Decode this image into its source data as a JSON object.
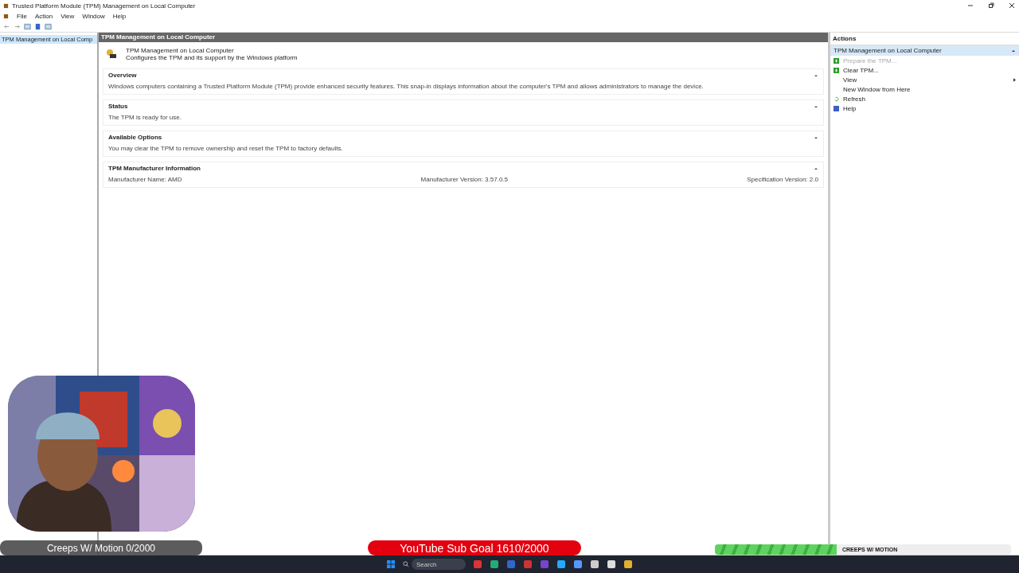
{
  "window": {
    "title": "Trusted Platform Module (TPM) Management on Local Computer"
  },
  "menu": [
    "File",
    "Action",
    "View",
    "Window",
    "Help"
  ],
  "tree": [
    {
      "label": "TPM Management on Local Comp",
      "selected": true
    }
  ],
  "content": {
    "header": "TPM Management on Local Computer",
    "intro_title": "TPM Management on Local Computer",
    "intro_text": "Configures the TPM and its support by the Windows platform",
    "sections": [
      {
        "title": "Overview",
        "kind": "text",
        "text": "Windows computers containing a Trusted Platform Module (TPM) provide enhanced security features. This snap-in displays information about the computer's TPM and allows administrators to manage the device."
      },
      {
        "title": "Status",
        "kind": "text",
        "text": "The TPM is ready for use."
      },
      {
        "title": "Available Options",
        "kind": "text",
        "text": "You may clear the TPM to remove ownership and reset the TPM to factory defaults."
      },
      {
        "title": "TPM Manufacturer Information",
        "kind": "fields",
        "fields": [
          "Manufacturer Name:  AMD",
          "Manufacturer Version:  3.57.0.5",
          "Specification Version:  2.0"
        ]
      }
    ]
  },
  "actions": {
    "title": "Actions",
    "group": "TPM Management on Local Computer",
    "items": [
      {
        "label": "Prepare the TPM...",
        "kind": "green",
        "disabled": true
      },
      {
        "label": "Clear TPM...",
        "kind": "green",
        "disabled": false
      },
      {
        "label": "View",
        "kind": "submenu",
        "disabled": false
      },
      {
        "label": "New Window from Here",
        "kind": "plain",
        "disabled": false
      },
      {
        "label": "Refresh",
        "kind": "refresh",
        "disabled": false
      },
      {
        "label": "Help",
        "kind": "help",
        "disabled": false
      }
    ]
  },
  "overlay": {
    "left_goal": "Creeps W/ Motion 0/2000",
    "center_goal": "YouTube Sub Goal 1610/2000",
    "bar_label": "CREEPS W/ MOTION",
    "level": 0.41
  },
  "taskbar": {
    "search": {
      "placeholder": "Search"
    }
  }
}
